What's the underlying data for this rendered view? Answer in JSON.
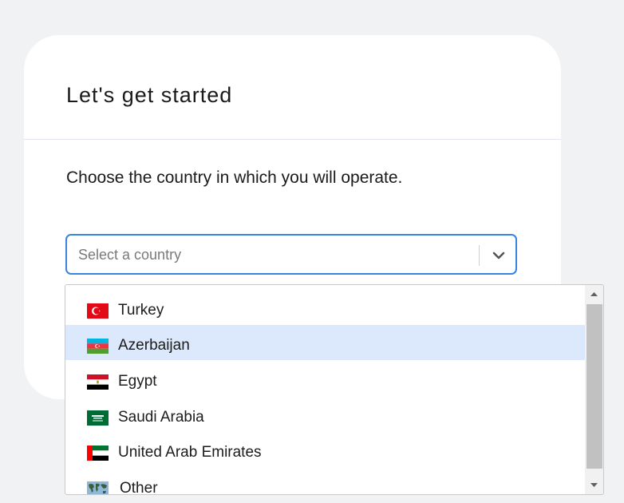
{
  "card": {
    "title": "Let's get started",
    "prompt": "Choose the country in which you will operate."
  },
  "select": {
    "placeholder": "Select a country",
    "icon": "chevron-down-icon"
  },
  "dropdown": {
    "highlighted_index": 1,
    "options": [
      {
        "label": "Turkey",
        "flag": "turkey-flag-icon"
      },
      {
        "label": "Azerbaijan",
        "flag": "azerbaijan-flag-icon"
      },
      {
        "label": "Egypt",
        "flag": "egypt-flag-icon"
      },
      {
        "label": "Saudi Arabia",
        "flag": "saudi-arabia-flag-icon"
      },
      {
        "label": "United Arab Emirates",
        "flag": "uae-flag-icon"
      },
      {
        "label": "Other",
        "flag": "world-map-icon"
      }
    ]
  },
  "colors": {
    "accent": "#3a83e0",
    "highlight": "#dce8fb",
    "background": "#f1f2f4"
  }
}
